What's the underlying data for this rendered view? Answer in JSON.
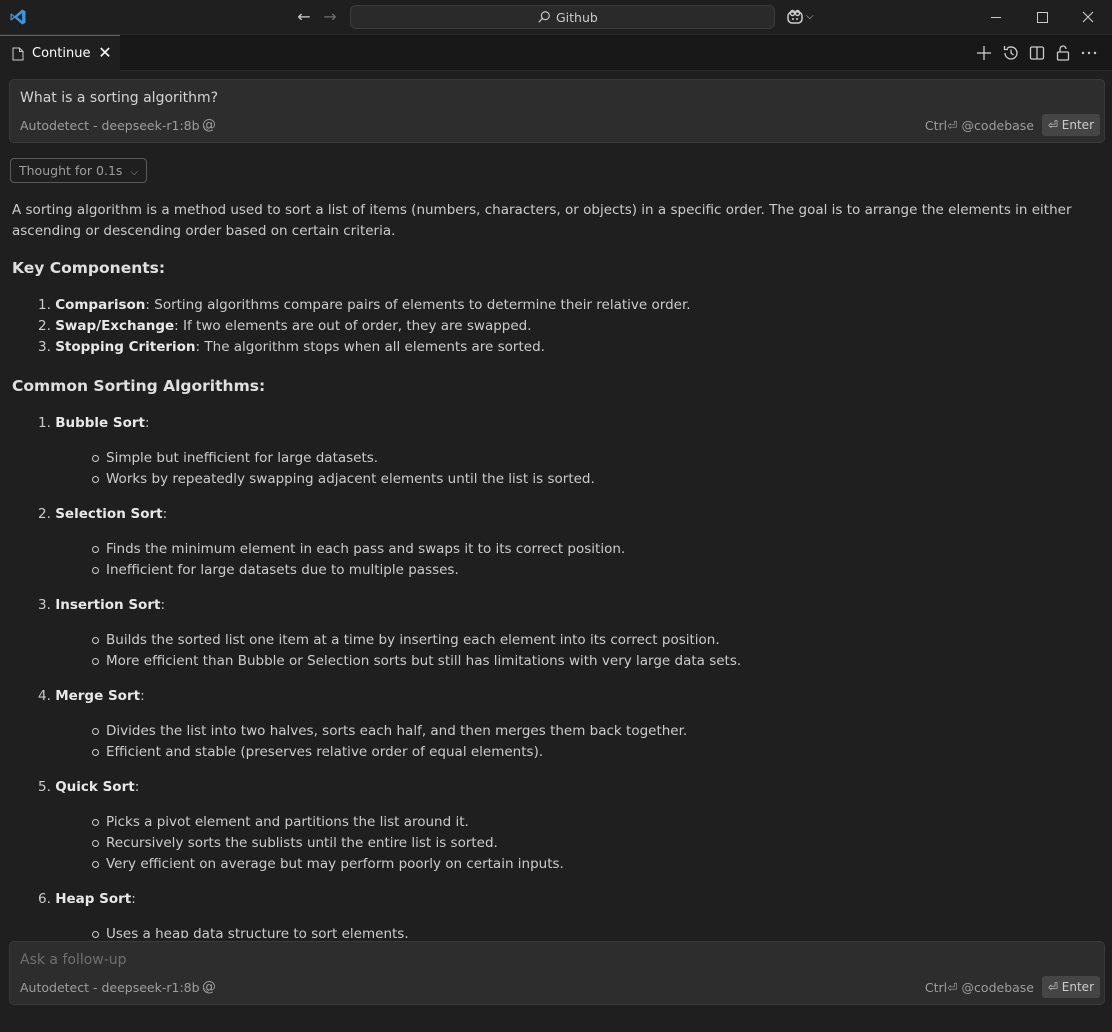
{
  "titlebar": {
    "search_text": "Github"
  },
  "tab": {
    "label": "Continue"
  },
  "top_input": {
    "query": "What is a sorting algorithm?",
    "model": "Autodetect - deepseek-r1:8b",
    "hint": "Ctrl⏎ @codebase",
    "enter_label": "⏎ Enter"
  },
  "thought": {
    "label": "Thought for 0.1s"
  },
  "response": {
    "intro": "A sorting algorithm is a method used to sort a list of items (numbers, characters, or objects) in a specific order. The goal is to arrange the elements in either ascending or descending order based on certain criteria.",
    "key_heading": "Key Components:",
    "key_items": [
      {
        "num": "1.",
        "term": "Comparison",
        "text": ": Sorting algorithms compare pairs of elements to determine their relative order."
      },
      {
        "num": "2.",
        "term": "Swap/Exchange",
        "text": ": If two elements are out of order, they are swapped."
      },
      {
        "num": "3.",
        "term": "Stopping Criterion",
        "text": ": The algorithm stops when all elements are sorted."
      }
    ],
    "common_heading": "Common Sorting Algorithms:",
    "algorithms": [
      {
        "num": "1.",
        "name": "Bubble Sort",
        "bullets": [
          "Simple but inefficient for large datasets.",
          "Works by repeatedly swapping adjacent elements until the list is sorted."
        ]
      },
      {
        "num": "2.",
        "name": "Selection Sort",
        "bullets": [
          "Finds the minimum element in each pass and swaps it to its correct position.",
          "Inefficient for large datasets due to multiple passes."
        ]
      },
      {
        "num": "3.",
        "name": "Insertion Sort",
        "bullets": [
          "Builds the sorted list one item at a time by inserting each element into its correct position.",
          "More efficient than Bubble or Selection sorts but still has limitations with very large data sets."
        ]
      },
      {
        "num": "4.",
        "name": "Merge Sort",
        "bullets": [
          "Divides the list into two halves, sorts each half, and then merges them back together.",
          "Efficient and stable (preserves relative order of equal elements)."
        ]
      },
      {
        "num": "5.",
        "name": "Quick Sort",
        "bullets": [
          "Picks a pivot element and partitions the list around it.",
          "Recursively sorts the sublists until the entire list is sorted.",
          "Very efficient on average but may perform poorly on certain inputs."
        ]
      },
      {
        "num": "6.",
        "name": "Heap Sort",
        "bullets": [
          "Uses a heap data structure to sort elements."
        ]
      }
    ]
  },
  "bottom_input": {
    "placeholder": "Ask a follow-up",
    "model": "Autodetect - deepseek-r1:8b",
    "hint": "Ctrl⏎ @codebase",
    "enter_label": "⏎ Enter"
  },
  "colors": {
    "accent": "#0078d4",
    "logo": "#3a96dd",
    "background": "#1f1f1f"
  }
}
